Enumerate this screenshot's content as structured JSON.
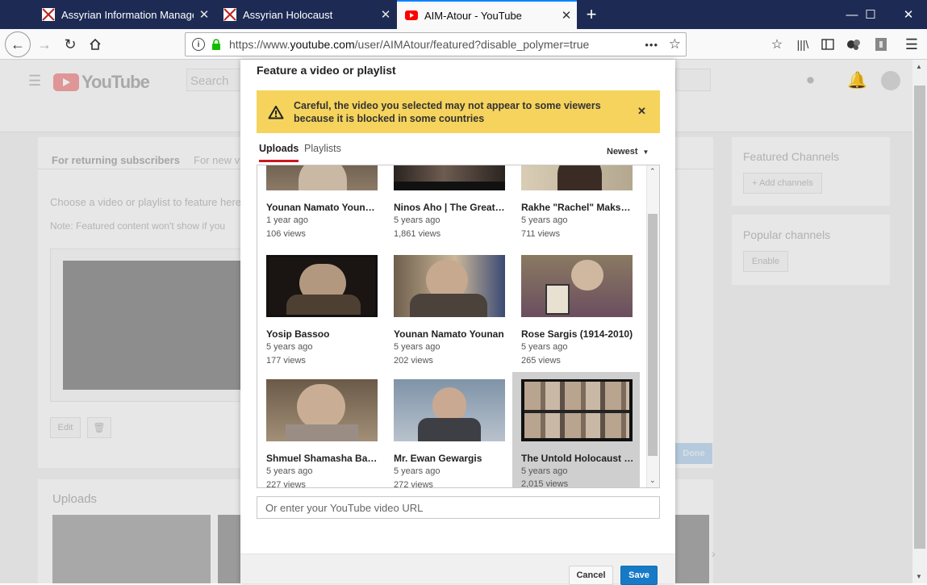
{
  "browser": {
    "tabs": [
      {
        "title": "Assyrian Information Management"
      },
      {
        "title": "Assyrian Holocaust"
      },
      {
        "title": "AIM-Atour - YouTube"
      }
    ],
    "new_tab": "+",
    "url_prefix": "https://www.",
    "url_domain": "youtube.com",
    "url_path": "/user/AIMAtour/featured?disable_polymer=true",
    "more": "•••"
  },
  "youtube": {
    "logo": "YouTube",
    "search_placeholder": "Search",
    "tab_returning": "For returning subscribers",
    "tab_new": "For new vi",
    "choose_text": "Choose a video or playlist to feature here",
    "note_text": "Note: Featured content won't show if you",
    "edit_label": "Edit",
    "done_label": "Done",
    "uploads_label": "Uploads",
    "featured_channels": "Featured Channels",
    "add_channels": "+ Add channels",
    "popular_channels": "Popular channels",
    "enable_label": "Enable"
  },
  "dialog": {
    "title": "Feature a video or playlist",
    "warning": "Careful, the video you selected may not appear to some viewers because it is blocked in some countries",
    "tabs": [
      "Uploads",
      "Playlists"
    ],
    "sort_label": "Newest",
    "url_placeholder": "Or enter your YouTube video URL",
    "cancel_label": "Cancel",
    "save_label": "Save",
    "videos": [
      {
        "title": "Younan Namato Younan...",
        "age": "1 year ago",
        "views": "106 views"
      },
      {
        "title": "Ninos Aho | The Great A...",
        "age": "5 years ago",
        "views": "1,861 views"
      },
      {
        "title": "Rakhe \"Rachel\" Maksud ...",
        "age": "5 years ago",
        "views": "711 views"
      },
      {
        "title": "Yosip Bassoo",
        "age": "5 years ago",
        "views": "177 views"
      },
      {
        "title": "Younan Namato Younan",
        "age": "5 years ago",
        "views": "202 views"
      },
      {
        "title": "Rose Sargis (1914-2010)",
        "age": "5 years ago",
        "views": "265 views"
      },
      {
        "title": "Shmuel Shamasha Bab...",
        "age": "5 years ago",
        "views": "227 views"
      },
      {
        "title": "Mr. Ewan Gewargis",
        "age": "5 years ago",
        "views": "272 views"
      },
      {
        "title": "The Untold Holocaust (...",
        "age": "5 years ago",
        "views": "2,015 views"
      }
    ]
  },
  "colors": {
    "tabstrip": "#1d2b54",
    "yt_red": "#ff0000",
    "warning": "#f5d35d",
    "save_blue": "#167ac6",
    "tab_underline": "#cc181e"
  }
}
